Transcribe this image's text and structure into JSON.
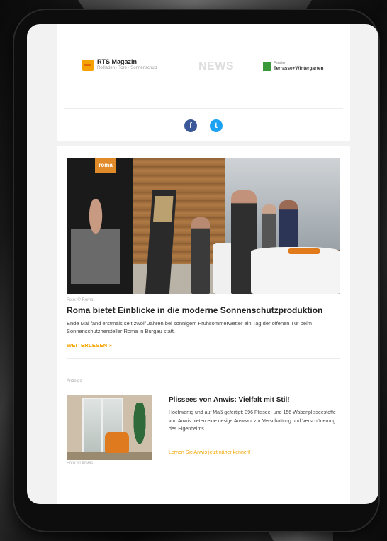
{
  "header": {
    "rts_title": "RTS Magazin",
    "rts_subtitle": "Rollladen · Tore · Sonnenschutz",
    "news_label": "NEWS",
    "tw_small": "Fenster",
    "tw_title": "Terrasse+Wintergarten"
  },
  "social": {
    "facebook": "f",
    "twitter": "t"
  },
  "article": {
    "image_sign": "roma",
    "caption": "Foto: © Roma",
    "headline": "Roma bietet Einblicke in die moderne Sonnenschutzproduktion",
    "teaser": "Ende Mai fand erstmals seit zwölf Jahren bei sonnigem Frühsommerwetter ein Tag der offenen Tür beim Sonnenschutzhersteller Roma in Burgau statt.",
    "readmore": "WEITERLESEN »"
  },
  "ad": {
    "label": "Anzeige",
    "title": "Plissees von Anwis: Vielfalt mit Stil!",
    "text": "Hochwertig und auf Maß gefertigt: 396 Plissee- und 156 Wabenplisseestoffe von Anwis bieten eine riesige Auswahl zur Verschattung und Verschönerung des Eigenheims.",
    "link": "Lernen Sie Anwis jetzt näher kennen!",
    "caption": "Foto: © Anwis"
  },
  "colors": {
    "accent": "#f3a500",
    "facebook": "#3b5998",
    "twitter": "#1da1f2",
    "rts_brand": "#f5a100"
  }
}
